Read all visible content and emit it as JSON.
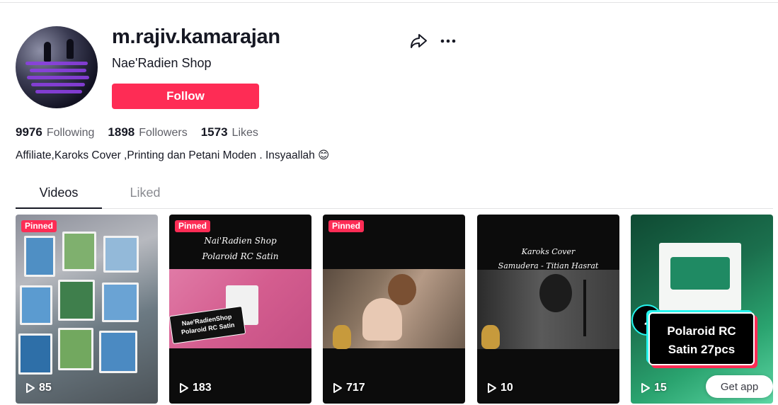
{
  "profile": {
    "username": "m.rajiv.kamarajan",
    "nickname": "Nae'Radien Shop",
    "follow_label": "Follow",
    "bio": "Affiliate,Karoks Cover ,Printing dan Petani Moden . Insyaallah 😊"
  },
  "stats": {
    "following_count": "9976",
    "following_label": "Following",
    "followers_count": "1898",
    "followers_label": "Followers",
    "likes_count": "1573",
    "likes_label": "Likes"
  },
  "actions": {
    "share_icon": "share-icon",
    "more_icon": "more-icon"
  },
  "tabs": [
    {
      "label": "Videos",
      "active": true
    },
    {
      "label": "Liked",
      "active": false
    }
  ],
  "videos": [
    {
      "pinned_label": "Pinned",
      "views": "85"
    },
    {
      "pinned_label": "Pinned",
      "views": "183",
      "overlay_line1": "Nai'Radien Shop",
      "overlay_line2": "Polaroid RC Satin",
      "sticker": "Nae'RadienShop\nPolaroid RC Satin"
    },
    {
      "pinned_label": "Pinned",
      "views": "717"
    },
    {
      "views": "10",
      "overlay_line1": "Karoks Cover",
      "overlay_line2": "Samudera - Titian Hasrat"
    },
    {
      "views": "15",
      "promo_line1": "Polaroid RC",
      "promo_line2": "Satin 27pcs",
      "get_app_label": "Get app"
    }
  ],
  "colors": {
    "accent": "#fe2c55",
    "text": "#161823",
    "muted": "#5f6068"
  }
}
